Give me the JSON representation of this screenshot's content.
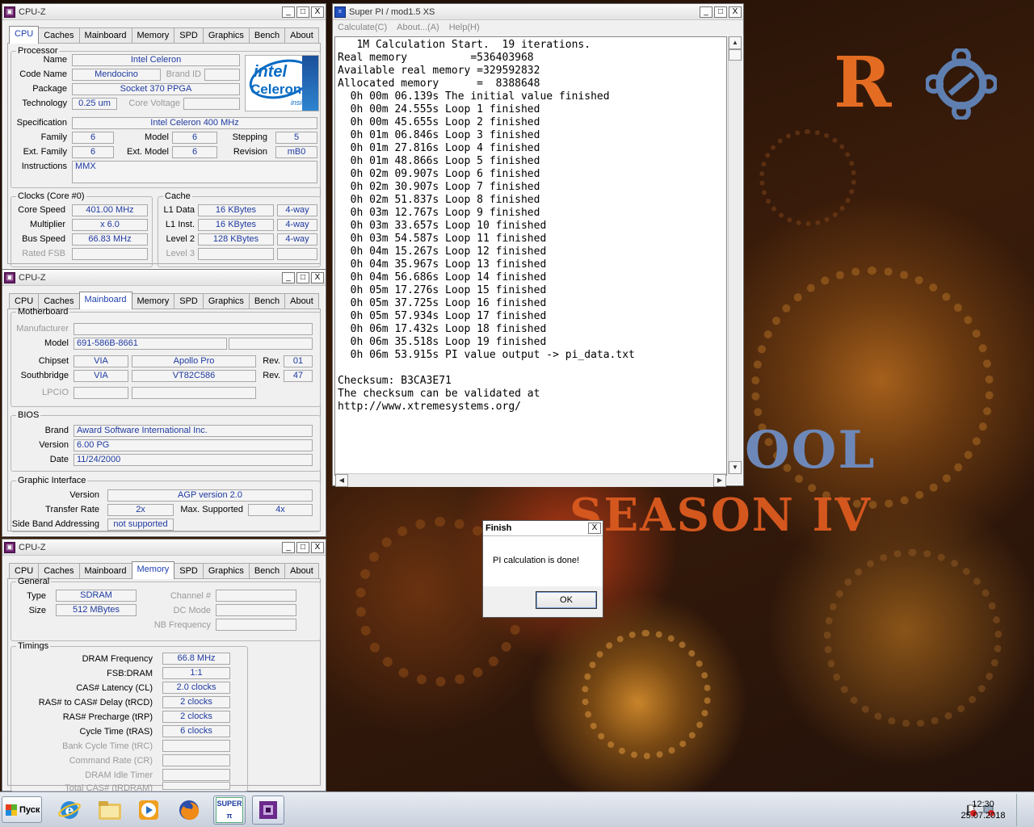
{
  "cpuz_common": {
    "title": "CPU-Z",
    "tabs": [
      "CPU",
      "Caches",
      "Mainboard",
      "Memory",
      "SPD",
      "Graphics",
      "Bench",
      "About"
    ],
    "win_min": "_",
    "win_max": "□",
    "win_close": "X"
  },
  "cpu": {
    "processor_legend": "Processor",
    "name_label": "Name",
    "name": "Intel Celeron",
    "codename_label": "Code Name",
    "codename": "Mendocino",
    "brandid_label": "Brand ID",
    "package_label": "Package",
    "package": "Socket 370 PPGA",
    "technology_label": "Technology",
    "technology": "0.25 um",
    "corevoltage_label": "Core Voltage",
    "spec_label": "Specification",
    "spec": "Intel Celeron 400 MHz",
    "family_label": "Family",
    "family": "6",
    "model_label": "Model",
    "model": "6",
    "stepping_label": "Stepping",
    "stepping": "5",
    "extfamily_label": "Ext. Family",
    "extfamily": "6",
    "extmodel_label": "Ext. Model",
    "extmodel": "6",
    "revision_label": "Revision",
    "revision": "mB0",
    "instructions_label": "Instructions",
    "instructions": "MMX",
    "logo_intel": "intel",
    "logo_celeron": "Celeron",
    "logo_inside": "inside",
    "clocks_legend": "Clocks (Core #0)",
    "corespeed_label": "Core Speed",
    "corespeed": "401.00 MHz",
    "multiplier_label": "Multiplier",
    "multiplier": "x 6.0",
    "busspeed_label": "Bus Speed",
    "busspeed": "66.83 MHz",
    "ratedfsb_label": "Rated FSB",
    "cache_legend": "Cache",
    "l1data_label": "L1 Data",
    "l1data": "16 KBytes",
    "l1data_way": "4-way",
    "l1inst_label": "L1 Inst.",
    "l1inst": "16 KBytes",
    "l1inst_way": "4-way",
    "level2_label": "Level 2",
    "level2": "128 KBytes",
    "level2_way": "4-way",
    "level3_label": "Level 3"
  },
  "mainboard": {
    "motherboard_legend": "Motherboard",
    "manufacturer_label": "Manufacturer",
    "model_label": "Model",
    "model": "691-586B-8661",
    "chipset_label": "Chipset",
    "chipset_vendor": "VIA",
    "chipset": "Apollo Pro",
    "chipset_rev_label": "Rev.",
    "chipset_rev": "01",
    "southbridge_label": "Southbridge",
    "sb_vendor": "VIA",
    "sb": "VT82C586",
    "sb_rev_label": "Rev.",
    "sb_rev": "47",
    "lpcio_label": "LPCIO",
    "bios_legend": "BIOS",
    "brand_label": "Brand",
    "brand": "Award Software International Inc.",
    "version_label": "Version",
    "version": "6.00 PG",
    "date_label": "Date",
    "date": "11/24/2000",
    "gi_legend": "Graphic Interface",
    "gi_version_label": "Version",
    "gi_version": "AGP version 2.0",
    "transfer_label": "Transfer Rate",
    "transfer": "2x",
    "maxsup_label": "Max. Supported",
    "maxsup": "4x",
    "sba_label": "Side Band Addressing",
    "sba": "not supported"
  },
  "memory": {
    "general_legend": "General",
    "type_label": "Type",
    "type": "SDRAM",
    "size_label": "Size",
    "size": "512 MBytes",
    "channel_label": "Channel #",
    "dcmode_label": "DC Mode",
    "nbfreq_label": "NB Frequency",
    "timings_legend": "Timings",
    "dramfreq_label": "DRAM Frequency",
    "dramfreq": "66.8 MHz",
    "fsbdram_label": "FSB:DRAM",
    "fsbdram": "1:1",
    "cas_label": "CAS# Latency (CL)",
    "cas": "2.0 clocks",
    "rcd_label": "RAS# to CAS# Delay (tRCD)",
    "rcd": "2 clocks",
    "rp_label": "RAS# Precharge (tRP)",
    "rp": "2 clocks",
    "ras_label": "Cycle Time (tRAS)",
    "ras": "6 clocks",
    "rc_label": "Bank Cycle Time (tRC)",
    "cr_label": "Command Rate (CR)",
    "idle_label": "DRAM Idle Timer",
    "trdram_label": "Total CAS# (tRDRAM)"
  },
  "superpi": {
    "title": "Super PI / mod1.5 XS",
    "icon_text": "SUPER π",
    "menu": [
      "Calculate(C)",
      "About...(A)",
      "Help(H)"
    ],
    "lines": [
      "   1M Calculation Start.  19 iterations.",
      "Real memory          =536403968",
      "Available real memory =329592832",
      "Allocated memory      =  8388648",
      "  0h 00m 06.139s The initial value finished",
      "  0h 00m 24.555s Loop 1 finished",
      "  0h 00m 45.655s Loop 2 finished",
      "  0h 01m 06.846s Loop 3 finished",
      "  0h 01m 27.816s Loop 4 finished",
      "  0h 01m 48.866s Loop 5 finished",
      "  0h 02m 09.907s Loop 6 finished",
      "  0h 02m 30.907s Loop 7 finished",
      "  0h 02m 51.837s Loop 8 finished",
      "  0h 03m 12.767s Loop 9 finished",
      "  0h 03m 33.657s Loop 10 finished",
      "  0h 03m 54.587s Loop 11 finished",
      "  0h 04m 15.267s Loop 12 finished",
      "  0h 04m 35.967s Loop 13 finished",
      "  0h 04m 56.686s Loop 14 finished",
      "  0h 05m 17.276s Loop 15 finished",
      "  0h 05m 37.725s Loop 16 finished",
      "  0h 05m 57.934s Loop 17 finished",
      "  0h 06m 17.432s Loop 18 finished",
      "  0h 06m 35.518s Loop 19 finished",
      "  0h 06m 53.915s PI value output -> pi_data.txt",
      "",
      "Checksum: B3CA3E71",
      "The checksum can be validated at",
      "http://www.xtremesystems.org/"
    ]
  },
  "dialog": {
    "title": "Finish",
    "message": "PI calculation is done!",
    "ok": "OK",
    "close": "X"
  },
  "wallpaper": {
    "logo_r": "R",
    "title_partial": "OOL",
    "season": "SEASON IV"
  },
  "taskbar": {
    "start": "Пуск",
    "time": "12:30",
    "date": "25.07.2018",
    "superpi_icon_text": "SUPER π"
  }
}
